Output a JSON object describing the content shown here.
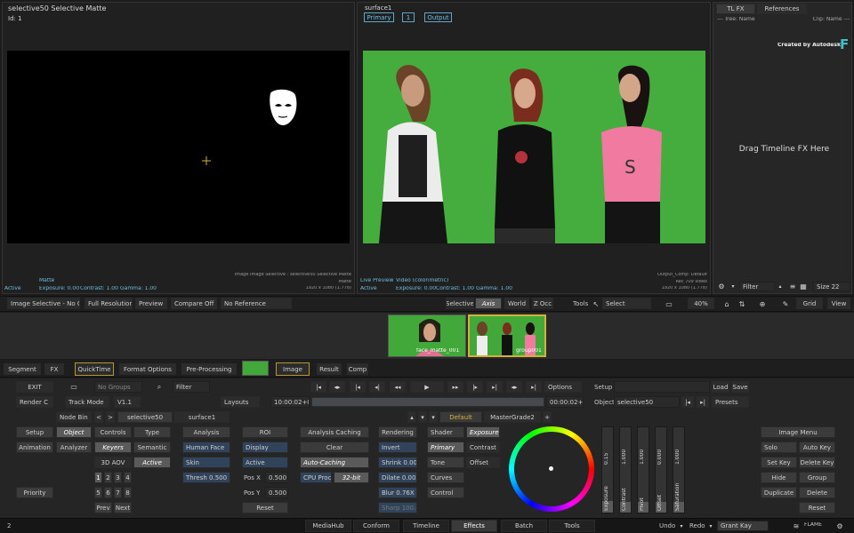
{
  "left_viewer": {
    "title": "selective50 Selective Matte",
    "id_label": "Id:  1",
    "footer_name": "Matte",
    "footer_status": "Active",
    "footer_exposure": "Exposure: 0.00",
    "footer_contrast": "Contrast: 1.00",
    "footer_gamma": "Gamma: 1.00",
    "footer_right_1": "Image Image Selective : selective50 Selective Matte",
    "footer_right_2": "Matte",
    "footer_right_3": "1920 x 1080 (1.778)"
  },
  "center_viewer": {
    "title": "surface1",
    "tag_primary": "Primary",
    "tag_num": "1",
    "tag_output": "Output",
    "footer_name": "Live Preview",
    "footer_video": "Video (colorimetric)",
    "footer_status": "Active",
    "footer_exposure": "Exposure: 0.00",
    "footer_contrast": "Contrast: 1.00",
    "footer_gamma": "Gamma: 1.00",
    "footer_right_1": "Output_Comp: Default",
    "footer_right_2": "Rec 709 video",
    "footer_right_3": "1920 x 1080 (1.778)"
  },
  "right_panel": {
    "tab_tlfx": "TL FX",
    "tab_references": "References",
    "col_tree": "--- Tree: Name",
    "col_clip": "Clip: Name ---",
    "created_by": "Created by Autodesk",
    "logo_letter": "F",
    "drag_text": "Drag Timeline FX Here",
    "filter_label": "Filter",
    "size_label": "Size 22"
  },
  "viewer_bar": {
    "image_selective": "Image Selective - No Obj",
    "full_resolution": "Full Resolution",
    "preview": "Preview",
    "compare_off": "Compare Off",
    "no_reference": "No Reference",
    "selective": "Selective",
    "axis": "Axis",
    "world": "World",
    "z_occ": "Z Occ",
    "tools": "Tools",
    "select": "Select",
    "zoom": "40%",
    "grid": "Grid",
    "view": "View"
  },
  "thumbs": {
    "thumb1_label": "face_matte_001",
    "thumb2_label": "group001"
  },
  "node_tabs": {
    "segment": "Segment",
    "fx": "FX",
    "quicktime": "QuickTime",
    "format_options": "Format Options",
    "pre_processing": "Pre-Processing",
    "image": "Image",
    "result": "Result",
    "comp": "Comp"
  },
  "transport": {
    "exit": "EXIT",
    "no_groups": "No Groups",
    "filter": "Filter",
    "options": "Options",
    "setup": "Setup",
    "load": "Load",
    "save": "Save",
    "render_c": "Render C",
    "track_mode": "Track Mode",
    "version": "V1.1",
    "layouts": "Layouts",
    "timecode_start": "10:00:02+00",
    "timecode_end": "00:00:02+12",
    "object_label": "Object",
    "object_value": "selective50",
    "presets": "Presets",
    "node_bin": "Node Bin",
    "node_selective": "selective50",
    "node_surface": "surface1",
    "default_tab": "Default",
    "mastergrade_tab": "MasterGrade2"
  },
  "controls": {
    "setup": "Setup",
    "object": "Object",
    "controls": "Controls",
    "type": "Type",
    "animation": "Animation",
    "analyzer": "Analyzer",
    "keyers": "Keyers",
    "semantic": "Semantic",
    "aov_3d": "3D AOV",
    "active_sel": "Active",
    "priority": "Priority",
    "n1": "1",
    "n2": "2",
    "n3": "3",
    "n4": "4",
    "n5": "5",
    "n6": "6",
    "n7": "7",
    "n8": "8",
    "prev": "Prev",
    "next": "Next",
    "analysis": "Analysis",
    "human_face": "Human Face",
    "skin": "Skin",
    "thresh": "Thresh 0.500",
    "roi": "ROI",
    "display": "Display",
    "active": "Active",
    "pos_x_label": "Pos X",
    "pos_x_value": "0.500",
    "pos_y_label": "Pos Y",
    "pos_y_value": "0.500",
    "reset": "Reset",
    "analysis_caching": "Analysis Caching",
    "clear": "Clear",
    "auto_caching": "Auto-Caching",
    "cpu_proc": "CPU Proc",
    "bit32": "32-bit",
    "rendering": "Rendering",
    "invert": "Invert",
    "shrink": "Shrink 0.00",
    "dilate": "Dilate 0.00X",
    "blur": "Blur 0.76X",
    "sharp": "Sharp 100.0",
    "shader": "Shader",
    "primary": "Primary",
    "tone": "Tone",
    "curves": "Curves",
    "control": "Control",
    "exposure_tab": "Exposure",
    "contrast_tab": "Contrast",
    "offset_tab": "Offset"
  },
  "sliders": [
    {
      "label": "Exposure",
      "value": "0.15",
      "level": 0.55
    },
    {
      "label": "Contrast",
      "value": "1.000",
      "level": 0.5
    },
    {
      "label": "Pivot",
      "value": "1.000",
      "level": 0.5
    },
    {
      "label": "Offset",
      "value": "0.000",
      "level": 0.5
    },
    {
      "label": "Saturation",
      "value": "1.000",
      "level": 0.5
    }
  ],
  "right_buttons": {
    "image_menu": "Image Menu",
    "solo": "Solo",
    "auto_key": "Auto Key",
    "set_key": "Set Key",
    "delete_key": "Delete Key",
    "hide": "Hide",
    "group": "Group",
    "duplicate": "Duplicate",
    "delete": "Delete",
    "reset": "Reset"
  },
  "bottom_bar": {
    "page_num": "2",
    "tabs": [
      "MediaHub",
      "Conform",
      "Timeline",
      "Effects",
      "Batch",
      "Tools"
    ],
    "undo": "Undo",
    "redo": "Redo",
    "user": "Grant Kay",
    "flame": "FLAME"
  },
  "colors": {
    "accent_blue": "#6fbfe0",
    "selected_yellow": "#d4b13a",
    "green_screen": "#3fa83a"
  }
}
